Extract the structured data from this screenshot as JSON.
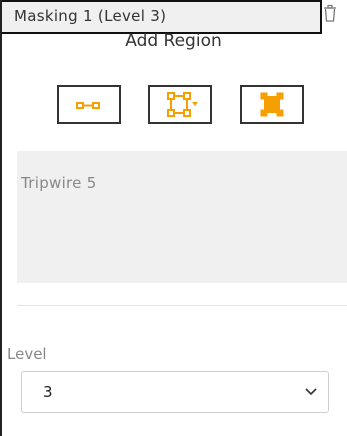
{
  "title": "Add Region",
  "tools": [
    {
      "name": "line-tool",
      "icon": "line-segment-icon"
    },
    {
      "name": "polygon-tool",
      "icon": "polygon-dropdown-icon"
    },
    {
      "name": "rectangle-tool",
      "icon": "filled-rectangle-icon"
    }
  ],
  "regions": {
    "items": [
      {
        "label": "Tripwire 5"
      },
      {
        "label": "Masking 1 (Level 3)",
        "action_icon": "trash-icon"
      }
    ]
  },
  "level": {
    "label": "Level",
    "value": "3",
    "dropdown_icon": "chevron-down-icon"
  },
  "colors": {
    "accent": "#f5a000",
    "panel": "#f0f0f0",
    "border": "#333333"
  }
}
